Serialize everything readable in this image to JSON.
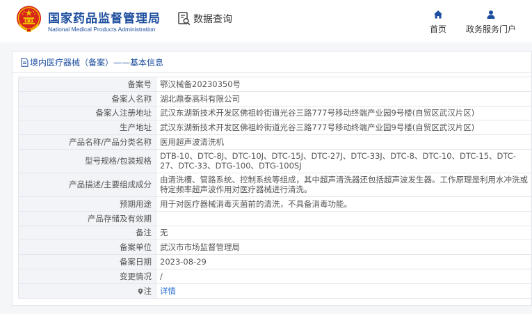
{
  "header": {
    "title_cn": "国家药品监督管理局",
    "title_en": "National Medical Products Administration",
    "search_title": "数据查询",
    "nav": [
      {
        "label": "首页",
        "icon": "home-icon"
      },
      {
        "label": "政务服务门户",
        "icon": "user-icon"
      }
    ]
  },
  "panel": {
    "title": "境内医疗器械（备案）——基本信息"
  },
  "record": {
    "rows": [
      {
        "key": "备案号",
        "value": "鄂汉械备20230350号"
      },
      {
        "key": "备案人名称",
        "value": "湖北鼎泰高科有限公司"
      },
      {
        "key": "备案人注册地址",
        "value": "武汉东湖新技术开发区佛祖岭街道光谷三路777号移动终端产业园9号楼(自贸区武汉片区)"
      },
      {
        "key": "生产地址",
        "value": "武汉东湖新技术开发区佛祖岭街道光谷三路777号移动终端产业园9号楼(自贸区武汉片区)"
      },
      {
        "key": "产品名称/产品分类名称",
        "value": "医用超声波清洗机"
      },
      {
        "key": "型号规格/包装规格",
        "value": "DTB-10、DTC-8J、DTC-10J、DTC-15J、DTC-27J、DTC-33J、DTC-8、DTC-10、DTC-15、DTC-27、DTC-33、DTG-100、DTG-100SJ"
      },
      {
        "key": "产品描述/主要组成成分",
        "value": "由清洗槽、管路系统、控制系统等组成，其中超声清洗器还包括超声波发生器。工作原理是利用水冲洗或特定频率超声波作用对医疗器械进行清洗。"
      },
      {
        "key": "预期用途",
        "value": "用于对医疗器械消毒灭菌前的清洗，不具备消毒功能。"
      },
      {
        "key": "产品存储及有效期",
        "value": ""
      },
      {
        "key": "备注",
        "value": "无"
      },
      {
        "key": "备案单位",
        "value": "武汉市市场监督管理局"
      },
      {
        "key": "备案日期",
        "value": "2023-08-29"
      },
      {
        "key": "变更情况",
        "value": "/"
      },
      {
        "key": "注",
        "value": "详情"
      }
    ]
  },
  "colors": {
    "brand_blue": "#1d4e9e",
    "link_blue": "#2a6fd0",
    "emblem_red": "#d8261c",
    "emblem_gold": "#f2c200"
  }
}
